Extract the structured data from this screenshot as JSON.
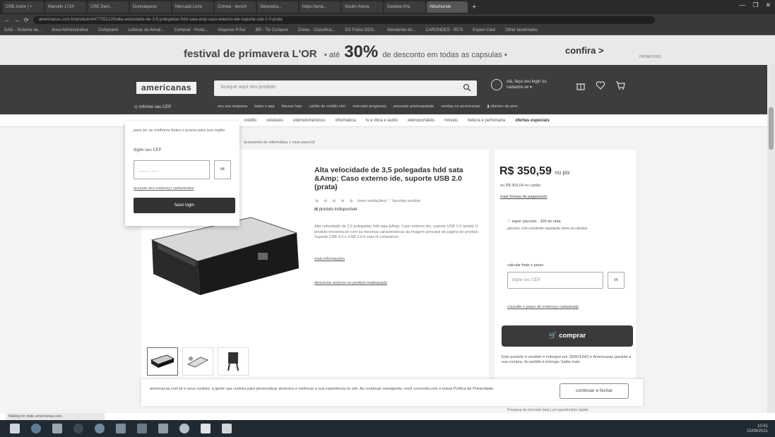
{
  "browser": {
    "tabs": [
      "CRE-Autor | +",
      "Marcelo 1724",
      "CRE Dem...",
      "Dunnaqueos",
      "Mercado Livre",
      "Crimea - bench",
      "Sibonetra...",
      "https://ama...",
      "Soulm Arena",
      "Geekbe b'ta",
      "Albumunde"
    ],
    "active_tab": 10,
    "window_controls": [
      "—",
      "❐",
      "✕"
    ],
    "url": "americanas.com.br/produto/4477052120/alta-velocidade-de-3-5-polegadas-hdd-sata-amp-caso-externo-ide-suporte-usb-2-0-prata",
    "nav_icons": [
      "←",
      "→",
      "⟳"
    ],
    "bookmarks": [
      "DAD - Sistema de...",
      "Area Administrativa",
      "Compraret",
      "Leituras do Annal...",
      "Comprar - Porta...",
      "Arquivos P.Sur",
      "BR - Tiv Curlaure",
      "Zonas - Classifica...",
      "DS Folios DDS...",
      "Atendente do...",
      "CARONDES - 0573",
      "Expert Care",
      "Other bookmarks"
    ]
  },
  "promo": {
    "headline": "festival de primavera L'OR",
    "pre": "• até",
    "big": "30%",
    "post": "de desconto em todas as capsulas •",
    "cta": "confira >",
    "legal": "PROMOVIDO"
  },
  "header": {
    "logo": "americanas",
    "search_placeholder": "busque aqui seu produto",
    "account_text": "olá, faça seu login ou cadastre-se ▾",
    "cep_link": "◎ informe seu CEP",
    "categories": [
      "seu sua empresa",
      "baixe o app",
      "faturas hoje",
      "cartão de crédito ofer",
      "mercado progresso",
      "presente aniversariante",
      "vendas no americanas",
      "▮ clientes da ame"
    ],
    "subnav": [
      "crédito",
      "celulares",
      "eletrodomésticos",
      "informática",
      "tv e ótica e áudio",
      "eletroportáteis",
      "móveis",
      "beleza e perfumaria",
      "ofertas especiais"
    ]
  },
  "breadcrumb": "acessórios de informática > case para hd",
  "cep_popup": {
    "text": "para ver as melhores fretes e prazos para sua região",
    "label": "digite seu CEP",
    "placeholder": "_____-___",
    "ok": "ok",
    "link": "acessar seu endereço cadastrados",
    "button": "fazer login"
  },
  "product": {
    "title": "Alta velocidade de 3,5 polegadas hdd sata &Amp; Caso externo ide, suporte USB 2.0 (prata)",
    "rating_text": "(sem avaliações)  ♡ favoritar produto",
    "stars": 5,
    "unavailable": "produto indisponível",
    "description": "Alta velocidade de 3,5 polegadas hdd sata &Amp; Caso externo ide, suporte USB 2.0 (prata) O produto encontra-se com as mesmas caracteristicas da imagem principal da página do produto. Suporte USB 3.0 e USB 2.0 é sata III compatível.",
    "more_info": "mais informações",
    "report": "denunciar anúncio ou produto inadequado"
  },
  "price_panel": {
    "price": "R$ 350,59",
    "price_suffix": "no pix",
    "pix": "ou R$ 369,04 no cartão",
    "installments": "mais formas de pagamento",
    "fulfill_title": "♡ super parceiro · 100 de nota",
    "fulfill_note": "parceiro com excelente reputação entre os clientes",
    "ship_label": "calcular frete e prazo",
    "ship_placeholder": "digite seu CEP",
    "ship_ok": "ok",
    "ship_unknown": "consulte o prazo do endereço cadastrado",
    "buy": "comprar",
    "sold_by": "Este produto é vendido e entregue por ZENOLINO e Americanas garante a sua compra, do pedido à entrega. Saiba mais"
  },
  "cookie": {
    "text": "americanas.com.br e seus cookies: a gente usa cookies para personalizar anúncios e melhorar a sua experiência no site. Ao continuar navegando, você concorda com a nossa Política de Privacidade.",
    "button": "continuar e fechar"
  },
  "bottom_link": "Pesquisa de mercado beta | um questionário rápido",
  "status_bar": "Waiting for static.americanas.com...",
  "tray": {
    "time": "10:41",
    "date": "15/09/2021"
  }
}
